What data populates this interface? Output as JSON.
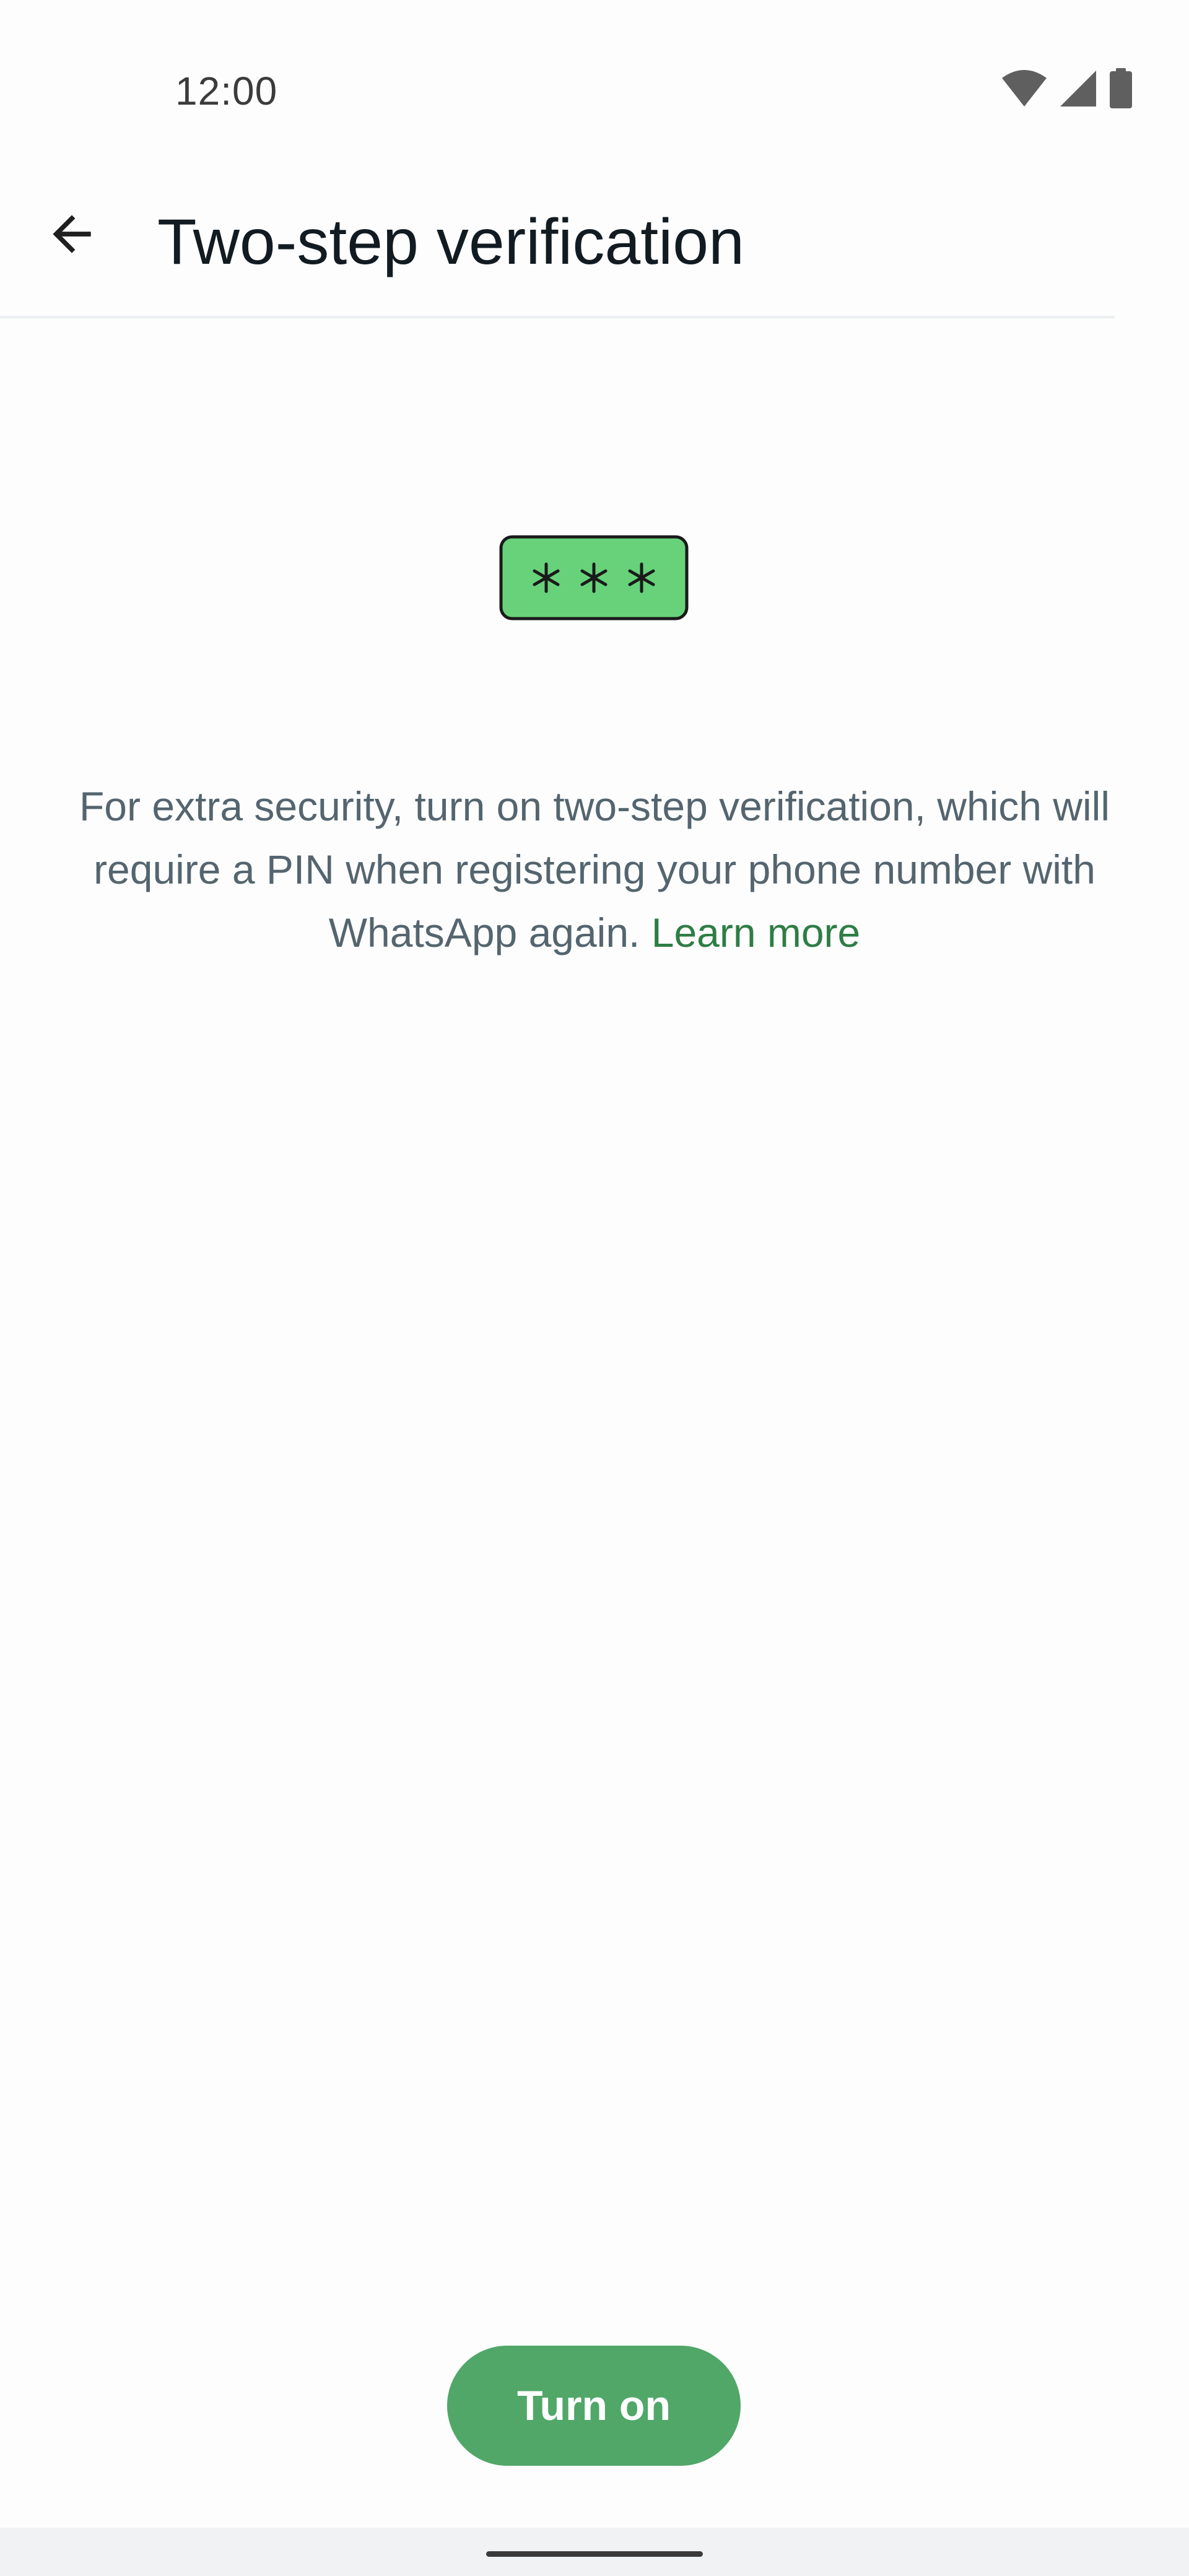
{
  "status_bar": {
    "time": "12:00",
    "icons": [
      "wifi-icon",
      "cellular-signal-icon",
      "battery-icon"
    ]
  },
  "app_bar": {
    "back_icon": "arrow-back-icon",
    "title": "Two-step verification"
  },
  "illustration": {
    "name": "pin-asterisks",
    "text": "* * *",
    "fill_color": "#67d27a",
    "stroke_color": "#1a1a1a"
  },
  "description": {
    "text": "For extra security, turn on two-step verification, which will require a PIN when registering your phone number with WhatsApp again.",
    "link": "Learn more"
  },
  "primary_action": {
    "label": "Turn on"
  },
  "colors": {
    "accent": "#50a768",
    "link": "#2e7d45",
    "body_text": "#54656f",
    "title_text": "#111b21"
  }
}
